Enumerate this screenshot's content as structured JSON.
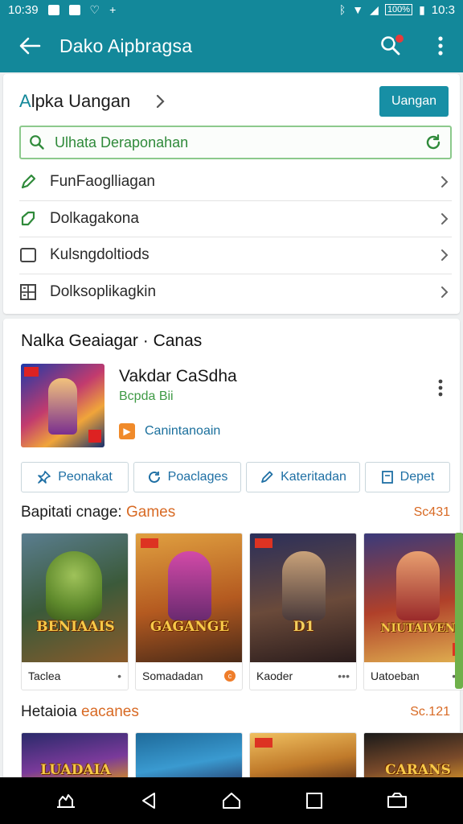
{
  "status_bar": {
    "time_left": "10:39",
    "battery": "100%",
    "time_right": "10:3"
  },
  "app_bar": {
    "title": "Dako Aipbragsa"
  },
  "header_card": {
    "title_accent": "A",
    "title_rest": "lpka Uangan",
    "button_label": "Uangan",
    "search_placeholder": "Ulhata Deraponahan",
    "menu": [
      {
        "label": "FunFaoglliagan",
        "icon": "pencil-icon"
      },
      {
        "label": "Dolkagakona",
        "icon": "tag-icon"
      },
      {
        "label": "Kulsngdoltiods",
        "icon": "checkbox-icon"
      },
      {
        "label": "Dolksoplikagkin",
        "icon": "grid-icon"
      }
    ]
  },
  "featured": {
    "section_title": "Nalka Geaiagar · Canas",
    "name": "Vakdar CaSdha",
    "subtitle": "Bcpda Bii",
    "tag_label": "Canintanoain"
  },
  "chips": [
    {
      "label": "Peonakat",
      "icon": "pin-icon"
    },
    {
      "label": "Poaclages",
      "icon": "refresh-icon"
    },
    {
      "label": "Kateritadan",
      "icon": "edit-icon"
    },
    {
      "label": "Depet",
      "icon": "document-icon"
    }
  ],
  "row1": {
    "title": "Bapitati cnage:",
    "title_accent": "Games",
    "count": "Sc431",
    "tiles": [
      {
        "title": "Taclea",
        "art_text": "BENIAAIS",
        "action": "•"
      },
      {
        "title": "Somadadan",
        "art_text": "GAGANGE",
        "action": "c"
      },
      {
        "title": "Kaoder",
        "art_text": "D1",
        "action": "•••"
      },
      {
        "title": "Uatoeban",
        "art_text": "NIUTAIVEN",
        "action": "•••"
      }
    ]
  },
  "row2": {
    "title": "Hetaioia",
    "title_accent": "eacanes",
    "count": "Sc.121",
    "tiles": [
      {
        "art_text": "LUADAIA"
      },
      {
        "art_text": ""
      },
      {
        "art_text": ""
      },
      {
        "art_text": "CARANS"
      }
    ]
  },
  "colors": {
    "primary": "#13889a",
    "accent_orange": "#d86a24",
    "green": "#3f9a45",
    "link_blue": "#1e6fa4"
  }
}
